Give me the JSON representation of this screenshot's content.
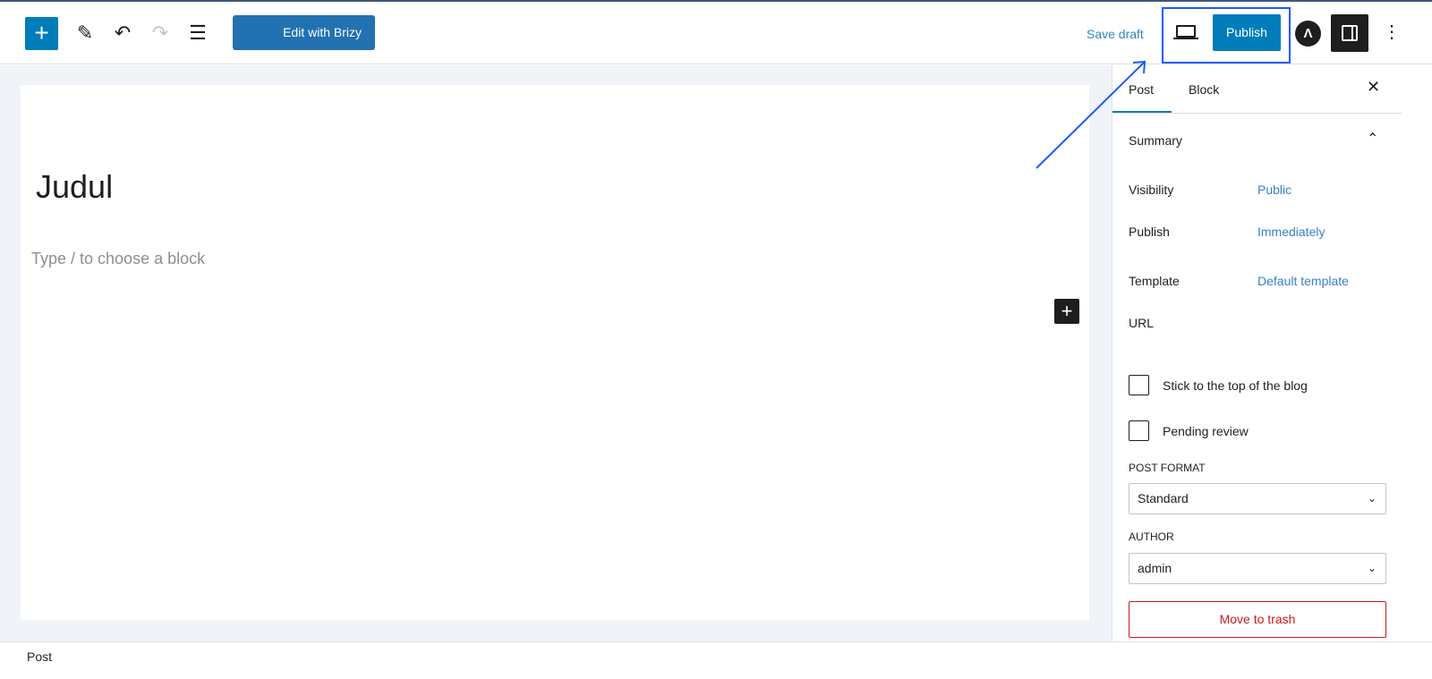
{
  "toolbar": {
    "add_icon": "plus-icon",
    "edit_icon": "pencil-icon",
    "undo_icon": "undo-icon",
    "redo_icon": "redo-icon",
    "list_icon": "list-view-icon",
    "brizy_label": "Edit with Brizy",
    "save_draft": "Save draft",
    "preview_icon": "laptop-icon",
    "publish_label": "Publish",
    "astra_icon": "astra-logo",
    "settings_icon": "sidebar-toggle-icon",
    "more_icon": "more-vertical-icon"
  },
  "editor": {
    "title": "Judul",
    "placeholder": "Type / to choose a block"
  },
  "sidebar": {
    "tabs": [
      "Post",
      "Block"
    ],
    "summary_title": "Summary",
    "rows": [
      {
        "label": "Visibility",
        "value": "Public"
      },
      {
        "label": "Publish",
        "value": "Immediately"
      },
      {
        "label": "Template",
        "value": "Default template"
      },
      {
        "label": "URL",
        "value": ""
      }
    ],
    "checkboxes": [
      {
        "label": "Stick to the top of the blog",
        "checked": false
      },
      {
        "label": "Pending review",
        "checked": false
      }
    ],
    "post_format_label": "POST FORMAT",
    "post_format_value": "Standard",
    "author_label": "AUTHOR",
    "author_value": "admin",
    "trash_label": "Move to trash"
  },
  "footer": {
    "breadcrumb": "Post"
  },
  "colors": {
    "accent": "#007cba",
    "highlight": "#1a5cff",
    "danger": "#cc1818"
  }
}
